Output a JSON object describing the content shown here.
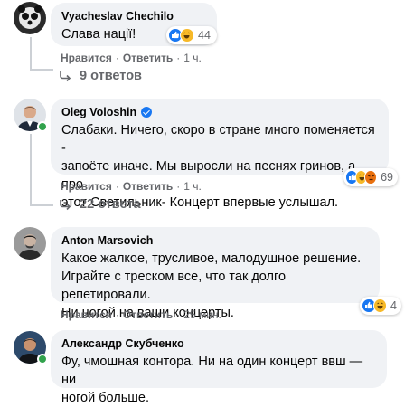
{
  "comments": [
    {
      "author": "Vyacheslav Chechilo",
      "text": [
        "Слава нації!"
      ],
      "reaction_count": "44",
      "reactions": [
        "like-icon",
        "laugh-icon"
      ],
      "actions": {
        "like": "Нравится",
        "reply": "Ответить",
        "time": "1 ч."
      },
      "replies": "9 ответов"
    },
    {
      "author": "Oleg Voloshin",
      "verified": true,
      "text": [
        "Слабаки. Ничего, скоро в стране много поменяется -",
        "запоёте иначе. Мы выросли на песнях гринов, а про",
        "этот Светильник- Концерт впервые услышал."
      ],
      "reaction_count": "69",
      "reactions": [
        "like-icon",
        "laugh-icon",
        "angry-icon"
      ],
      "actions": {
        "like": "Нравится",
        "reply": "Ответить",
        "time": "1 ч."
      },
      "replies": "22 ответа"
    },
    {
      "author": "Anton Marsovich",
      "text": [
        "Какое жалкое, трусливое, малодушное решение.",
        "Играйте с треском все, что так долго репетировали.",
        "Ни ногой на ваши концерты."
      ],
      "reaction_count": "4",
      "reactions": [
        "like-icon",
        "laugh-icon"
      ],
      "actions": {
        "like": "Нравится",
        "reply": "Ответить",
        "time": "25 мин."
      }
    },
    {
      "author": "Александр Скубченко",
      "text": [
        "Фу, чмошная контора. Ни на один концерт ввш — ни",
        "ногой больше."
      ]
    }
  ],
  "colors": {
    "accent": "#1877f2",
    "online": "#31a24c",
    "bubble": "#f0f2f5",
    "secondary_text": "#65676b"
  }
}
